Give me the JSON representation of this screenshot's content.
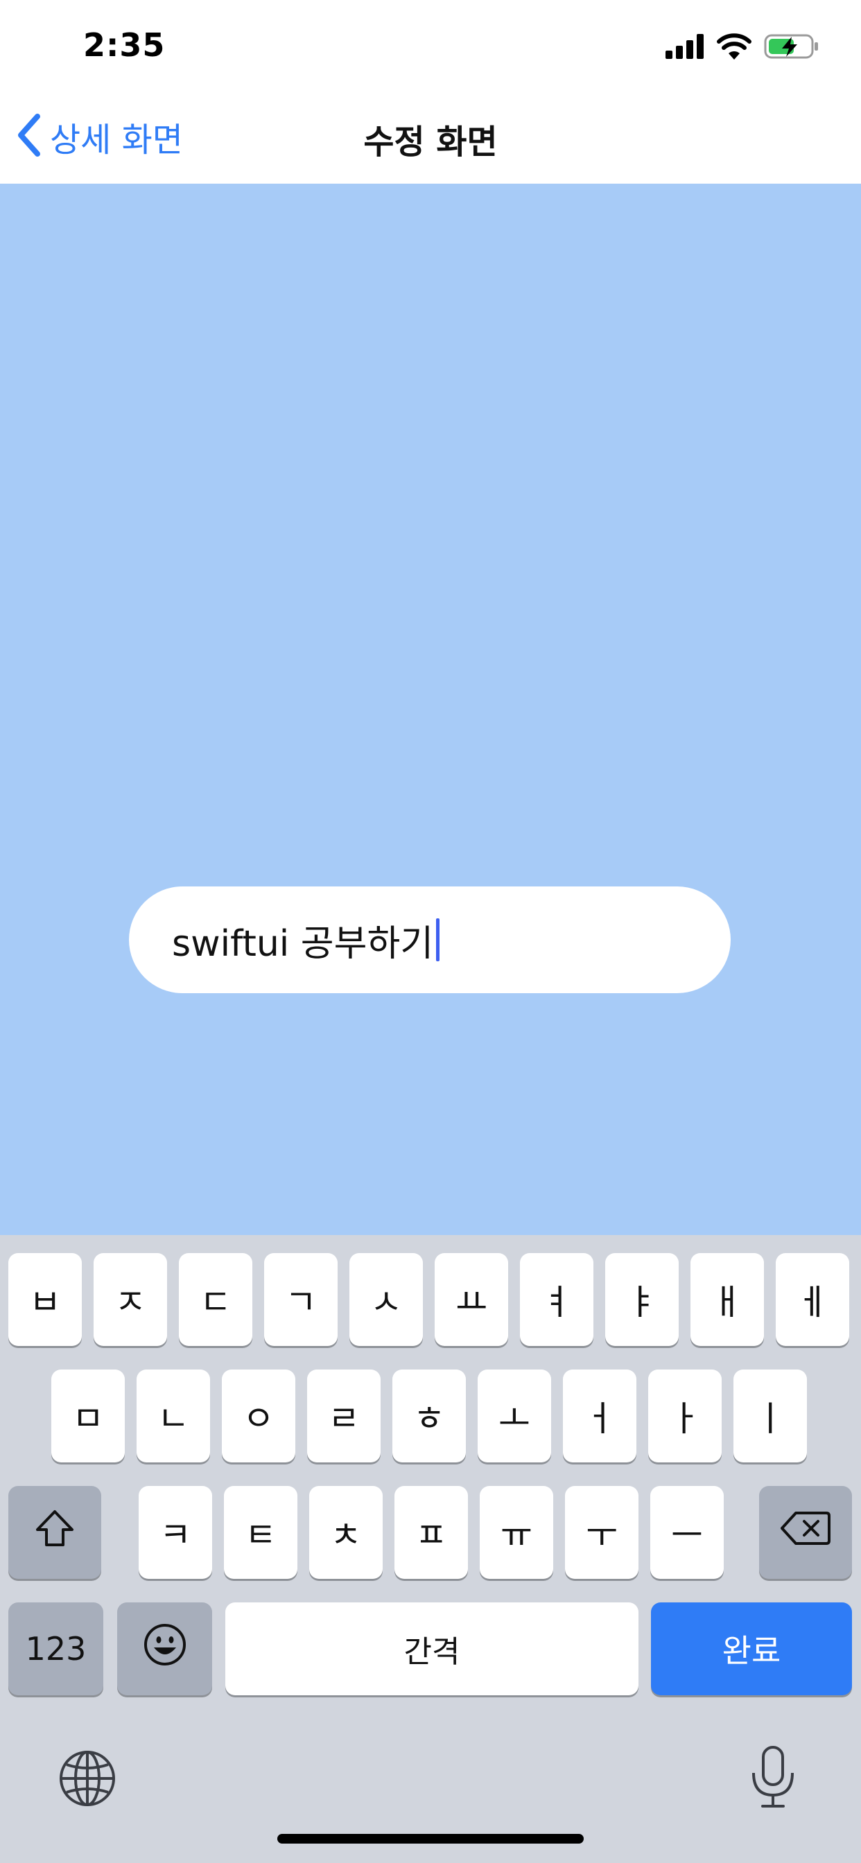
{
  "status_bar": {
    "time": "2:35",
    "icons": [
      "cellular-signal-icon",
      "wifi-icon",
      "battery-charging-icon"
    ],
    "battery_color": "#34c759"
  },
  "nav": {
    "back_label": "상세 화면",
    "title": "수정 화면",
    "accent_color": "#2f7cf6"
  },
  "text_field": {
    "value": "swiftui 공부하기"
  },
  "keyboard": {
    "row1": [
      "ㅂ",
      "ㅈ",
      "ㄷ",
      "ㄱ",
      "ㅅ",
      "ㅛ",
      "ㅕ",
      "ㅑ",
      "ㅐ",
      "ㅔ"
    ],
    "row2": [
      "ㅁ",
      "ㄴ",
      "ㅇ",
      "ㄹ",
      "ㅎ",
      "ㅗ",
      "ㅓ",
      "ㅏ",
      "ㅣ"
    ],
    "row3": [
      "ㅋ",
      "ㅌ",
      "ㅊ",
      "ㅍ",
      "ㅠ",
      "ㅜ",
      "ㅡ"
    ],
    "numbers_label": "123",
    "space_label": "간격",
    "done_label": "완료",
    "icons": [
      "shift-icon",
      "delete-icon",
      "emoji-icon",
      "globe-icon",
      "microphone-icon"
    ]
  },
  "colors": {
    "background": "#a7cbf7",
    "keyboard_bg": "#d1d5dd",
    "caret": "#3d5ff0"
  }
}
